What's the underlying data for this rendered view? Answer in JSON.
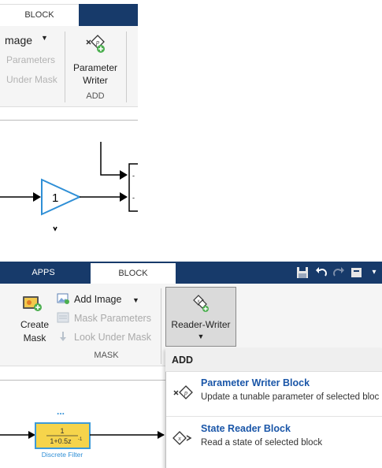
{
  "top": {
    "tab_block": "BLOCK",
    "add_image": "mage",
    "mask_parameters": "Parameters",
    "look_under_mask": "Under Mask",
    "param_writer_line1": "Parameter",
    "param_writer_line2": "Writer",
    "add_section": "ADD",
    "gain_value": "1"
  },
  "bottom": {
    "tab_apps": "APPS",
    "tab_block": "BLOCK",
    "create_mask_line1": "Create",
    "create_mask_line2": "Mask",
    "add_image": "Add Image",
    "mask_parameters": "Mask Parameters",
    "look_under_mask": "Look Under Mask",
    "mask_section": "MASK",
    "reader_writer": "Reader-Writer",
    "ellipsis": "...",
    "tf_numerator": "1",
    "tf_denominator": "1+0.5z",
    "tf_exponent": "-1",
    "block_caption": "Discrete Filter",
    "menu": {
      "header": "ADD",
      "items": [
        {
          "title": "Parameter Writer Block",
          "desc": "Update a tunable parameter of selected bloc",
          "icon": "parameter-writer-icon"
        },
        {
          "title": "State Reader Block",
          "desc": "Read a state of selected block",
          "icon": "state-reader-icon"
        }
      ]
    }
  },
  "colors": {
    "tabbar": "#173a6a",
    "accent": "#1a56a8",
    "block_fill": "#f6d44b",
    "block_border": "#3d9ad8"
  }
}
